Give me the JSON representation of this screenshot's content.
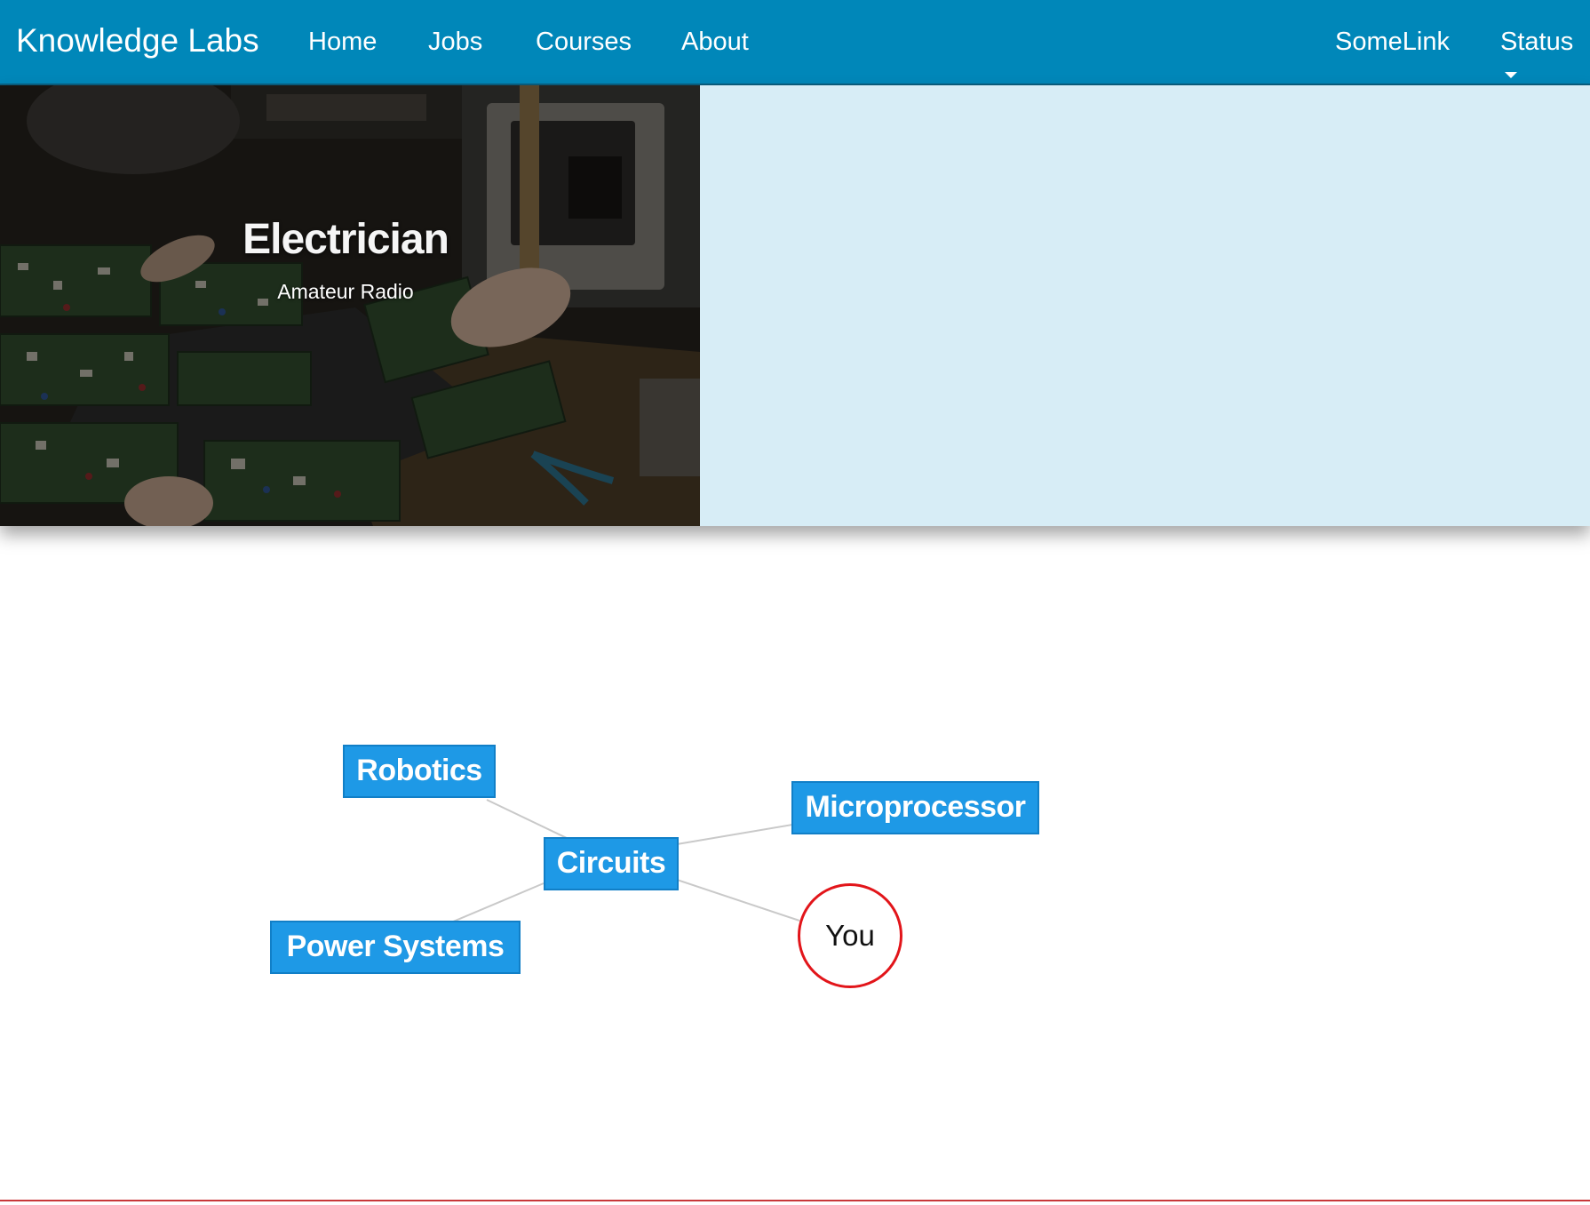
{
  "navbar": {
    "brand": "Knowledge Labs",
    "links": [
      "Home",
      "Jobs",
      "Courses",
      "About"
    ],
    "right_links": [
      "SomeLink",
      "Status"
    ],
    "colors": {
      "background": "#0087b9",
      "text": "#ffffff"
    }
  },
  "hero": {
    "title": "Electrician",
    "subtitle": "Amateur Radio",
    "image": "electronics-workbench-photo",
    "colors": {
      "panel": "#d7edf6"
    }
  },
  "graph": {
    "nodes": {
      "robotics": "Robotics",
      "circuits": "Circuits",
      "microprocessor": "Microprocessor",
      "power_systems": "Power Systems",
      "you": "You"
    },
    "edges": [
      [
        "Robotics",
        "Circuits"
      ],
      [
        "Circuits",
        "Microprocessor"
      ],
      [
        "Circuits",
        "Power Systems"
      ],
      [
        "Circuits",
        "You"
      ]
    ],
    "colors": {
      "node": "#1e99e6",
      "you_border": "#e2151a",
      "edge": "#c9c9c9"
    }
  }
}
